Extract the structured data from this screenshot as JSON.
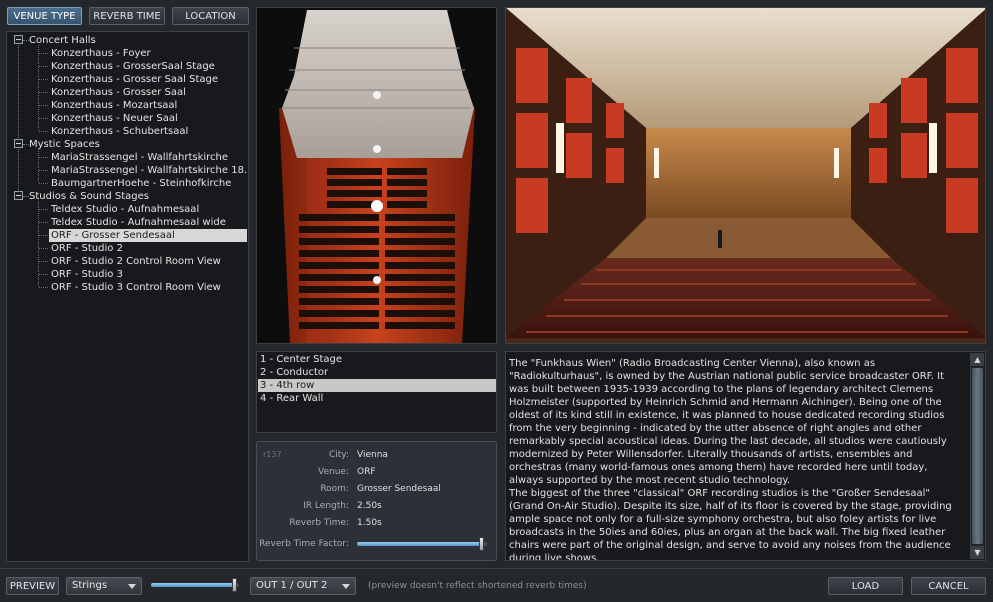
{
  "top_tabs": [
    {
      "label": "VENUE TYPE",
      "active": true
    },
    {
      "label": "REVERB TIME",
      "active": false
    },
    {
      "label": "LOCATION",
      "active": false
    }
  ],
  "tree": {
    "groups": [
      {
        "label": "Concert Halls",
        "items": [
          "Konzerthaus - Foyer",
          "Konzerthaus - GrosserSaal Stage",
          "Konzerthaus - Grosser Saal Stage",
          "Konzerthaus - Grosser Saal",
          "Konzerthaus - Mozartsaal",
          "Konzerthaus - Neuer Saal",
          "Konzerthaus - Schubertsaal"
        ]
      },
      {
        "label": "Mystic Spaces",
        "items": [
          "MariaStrassengel - Wallfahrtskirche",
          "MariaStrassengel - Wallfahrtskirche 18...",
          "BaumgartnerHoehe - Steinhofkirche"
        ]
      },
      {
        "label": "Studios & Sound Stages",
        "items": [
          "Teldex Studio - Aufnahmesaal",
          "Teldex Studio - Aufnahmesaal wide",
          "ORF - Grosser Sendesaal",
          "ORF - Studio 2",
          "ORF - Studio 2 Control Room View",
          "ORF - Studio 3",
          "ORF - Studio 3 Control Room View"
        ]
      }
    ],
    "selected": "ORF - Grosser Sendesaal"
  },
  "positions": {
    "items": [
      "1 - Center Stage",
      "2 - Conductor",
      "3 - 4th row",
      "4 - Rear Wall"
    ],
    "selected_index": 2
  },
  "info": {
    "id": "r137",
    "city_label": "City:",
    "city": "Vienna",
    "venue_label": "Venue:",
    "venue": "ORF",
    "room_label": "Room:",
    "room": "Grosser Sendesaal",
    "ir_label": "IR Length:",
    "ir_length": "2.50s",
    "reverb_label": "Reverb Time:",
    "reverb_time": "1.50s",
    "factor_label": "Reverb Time Factor:",
    "factor_level": 0.96
  },
  "description": {
    "p1": "The \"Funkhaus Wien\" (Radio Broadcasting Center Vienna), also known as \"Radiokulturhaus\", is owned by the Austrian national public service broadcaster ORF. It was built between 1935-1939 according to the plans of legendary architect Clemens Holzmeister (supported by Heinrich Schmid and Hermann Aichinger). Being one of the oldest of its kind still in existence, it was planned to house dedicated recording studios from the very beginning - indicated by the utter absence of right angles and other remarkably special acoustical ideas. During the last decade, all studios were cautiously modernized by Peter Willensdorfer. Literally thousands of artists, ensembles and orchestras (many world-famous ones among them) have recorded here until today, always supported by the most recent studio technology.",
    "p2": "The biggest of the three \"classical\" ORF recording studios is the \"Großer Sendesaal\" (Grand On-Air Studio). Despite its size, half of its floor is covered by the stage, providing ample space not only for a full-size symphony orchestra, but also foley artists for live broadcasts in the 50ies and 60ies, plus an organ at the back wall. The big fixed leather chairs were part of the original design, and serve to avoid any noises from the audience during live shows."
  },
  "bottom": {
    "preview_label": "PREVIEW",
    "instrument": "Strings",
    "preview_level": 0.96,
    "output": "OUT 1 / OUT 2",
    "note": "(preview doesn't reflect shortened reverb times)",
    "load_label": "LOAD",
    "cancel_label": "CANCEL"
  },
  "colors": {
    "accent": "#4b6d8c",
    "selection": "#d7d7d7",
    "hall_red": "#c8421d"
  }
}
